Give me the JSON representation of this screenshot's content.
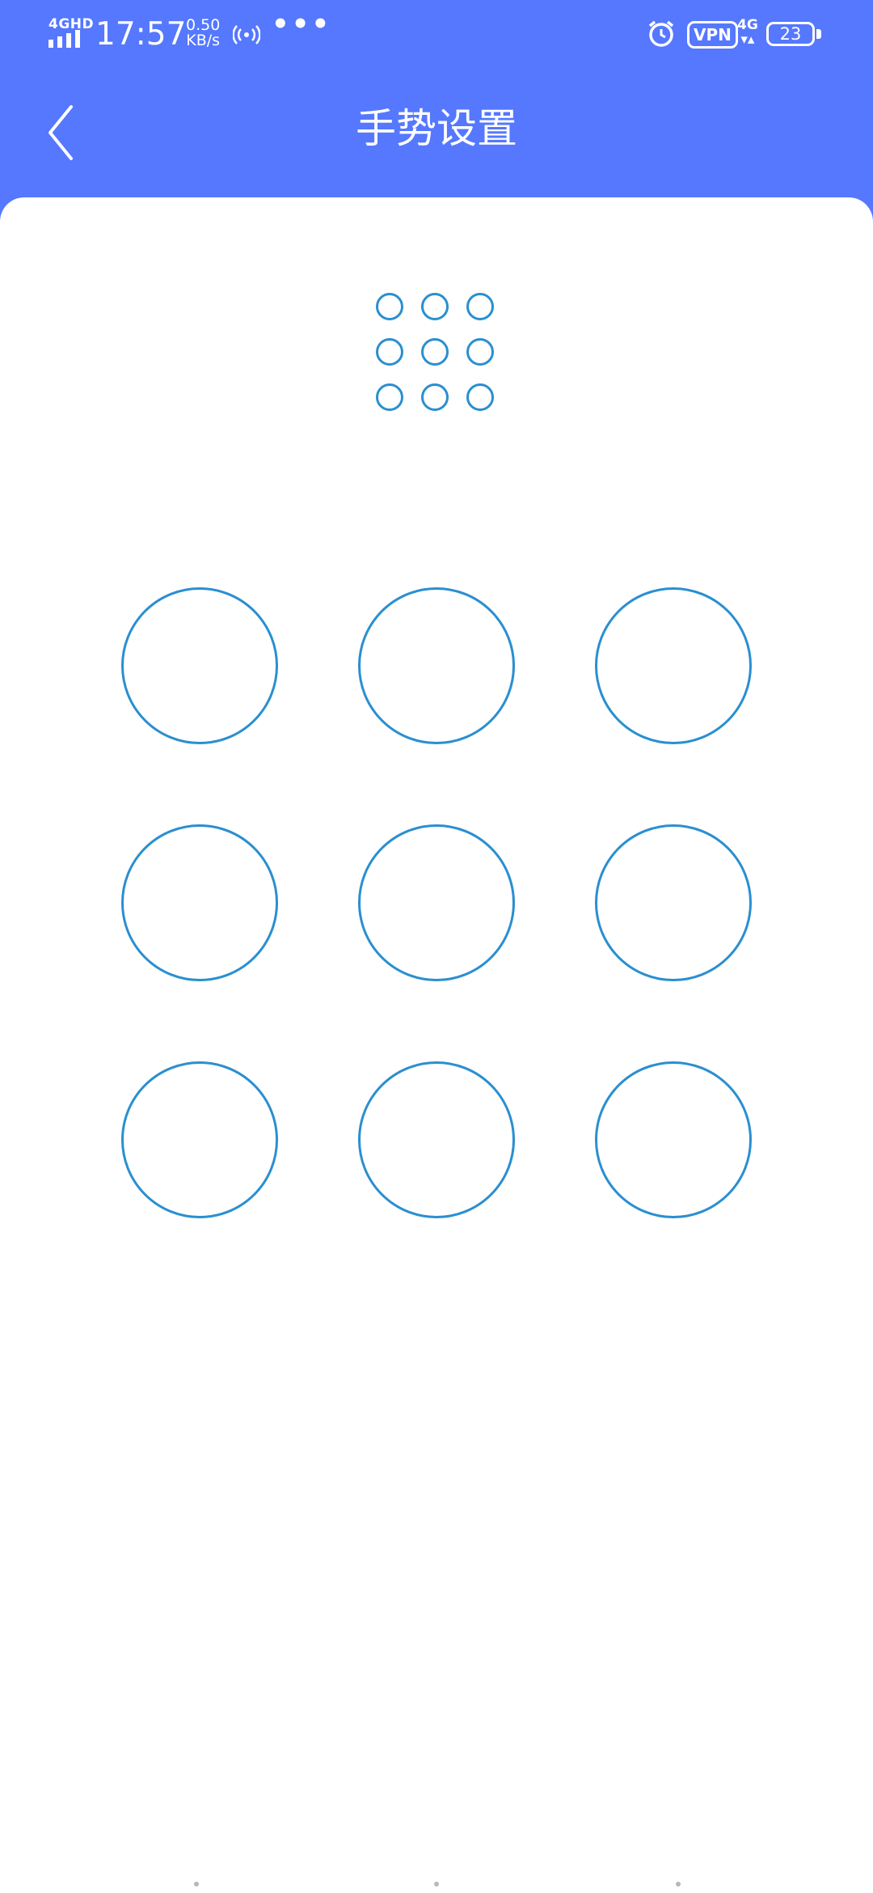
{
  "status_bar": {
    "network_type": "4GHD",
    "time": "17:57",
    "speed_value": "0.50",
    "speed_unit": "KB/s",
    "more": "•••",
    "vpn": "VPN",
    "network_type_2": "4G",
    "battery": "23",
    "icons": [
      "signal-icon",
      "hotspot-icon",
      "alarm-icon",
      "battery-icon"
    ]
  },
  "header": {
    "title": "手势设置",
    "back_icon": "chevron-left-icon"
  },
  "gesture": {
    "preview_dot_count": 9,
    "node_count": 9,
    "stroke_color": "#2a8fd0"
  },
  "theme": {
    "header_color": "#5578ff",
    "background": "#ffffff"
  }
}
